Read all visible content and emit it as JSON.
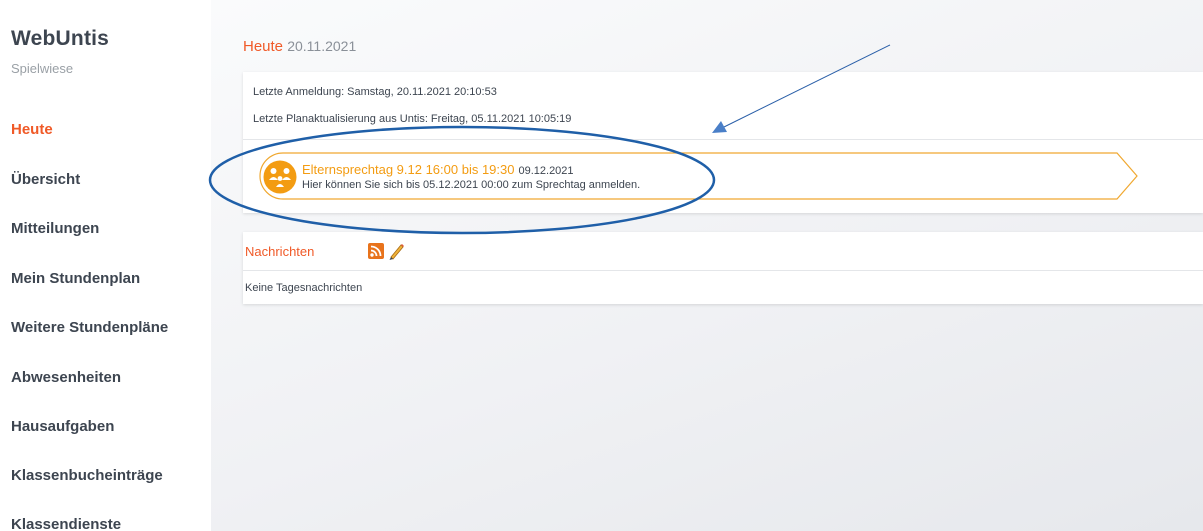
{
  "sidebar": {
    "brand": "WebUntis",
    "subtitle": "Spielwiese",
    "items": [
      {
        "label": "Heute",
        "active": true
      },
      {
        "label": "Übersicht",
        "active": false
      },
      {
        "label": "Mitteilungen",
        "active": false
      },
      {
        "label": "Mein Stundenplan",
        "active": false
      },
      {
        "label": "Weitere Stundenpläne",
        "active": false
      },
      {
        "label": "Abwesenheiten",
        "active": false
      },
      {
        "label": "Hausaufgaben",
        "active": false
      },
      {
        "label": "Klassenbucheinträge",
        "active": false
      },
      {
        "label": "Klassendienste",
        "active": false
      }
    ]
  },
  "main": {
    "title": "Heute",
    "date": "20.11.2021",
    "last_login": "Letzte Anmeldung: Samstag, 20.11.2021 20:10:53",
    "last_update": "Letzte Planaktualisierung aus Untis: Freitag, 05.11.2021 10:05:19",
    "event": {
      "icon": "parents-meeting-icon",
      "title": "Elternsprechtag 9.12 16:00 bis 19:30",
      "date": "09.12.2021",
      "description": "Hier können Sie sich bis 05.12.2021 00:00 zum Sprechtag anmelden."
    },
    "news": {
      "title": "Nachrichten",
      "icons": [
        "rss-icon",
        "pencil-icon"
      ],
      "empty_text": "Keine Tagesnachrichten"
    }
  },
  "colors": {
    "accent": "#f05a28",
    "event_orange": "#f39c12",
    "annotation_blue": "#1f5fa8",
    "text_dark": "#3d4550"
  }
}
